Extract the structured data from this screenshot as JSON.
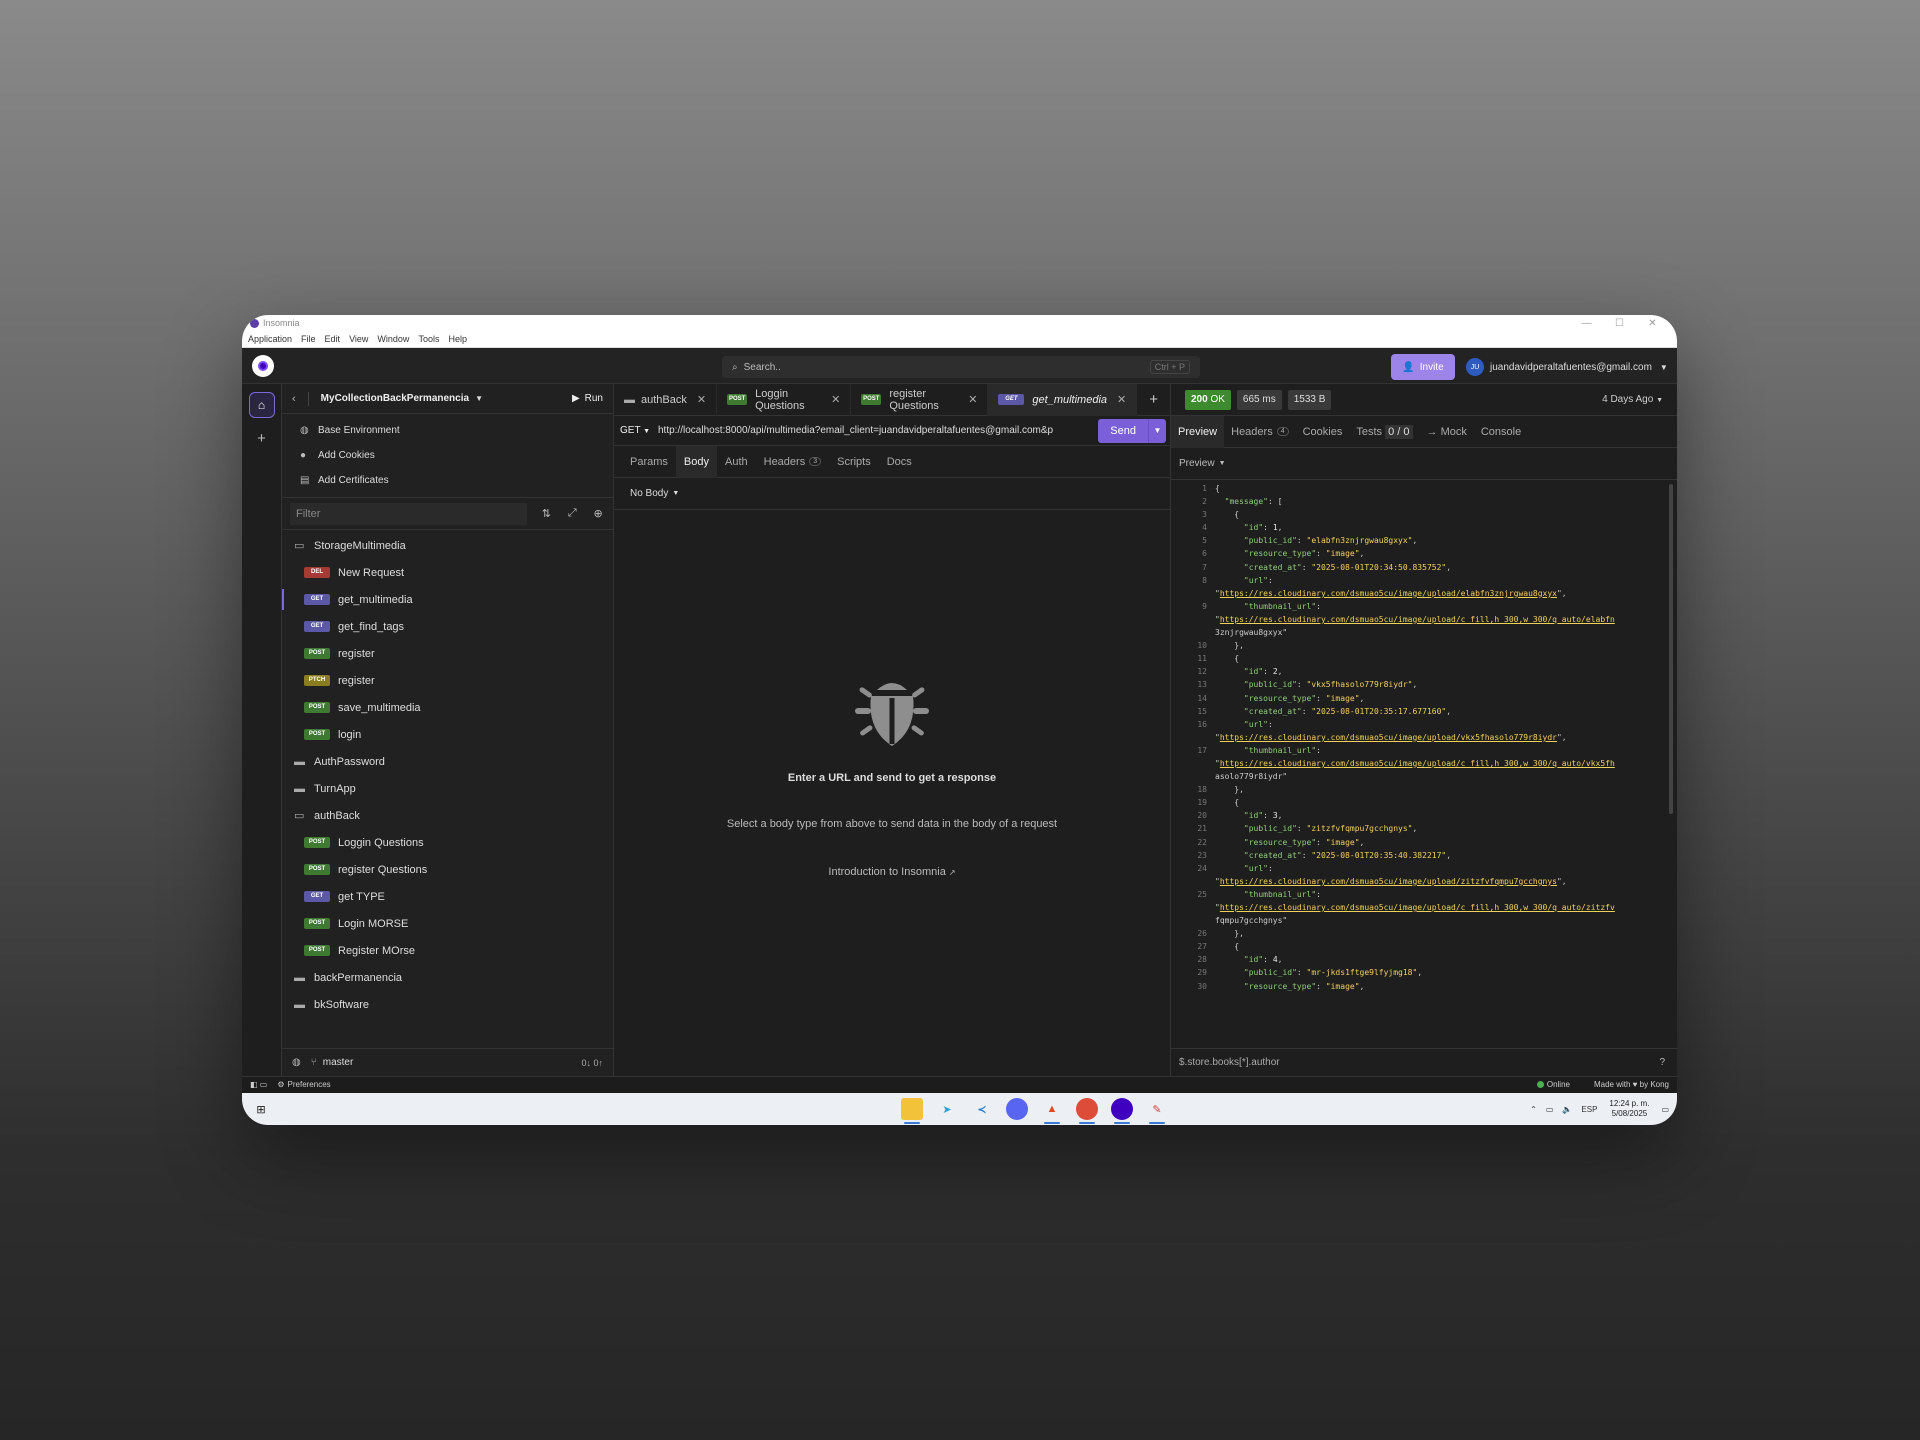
{
  "window": {
    "title": "Insomnia",
    "menu": [
      "Application",
      "File",
      "Edit",
      "View",
      "Window",
      "Tools",
      "Help"
    ]
  },
  "topbar": {
    "search_placeholder": "Search..",
    "search_shortcut": "Ctrl + P",
    "invite_label": "Invite",
    "user_initials": "JU",
    "user_email": "juandavidperaltafuentes@gmail.com"
  },
  "sidebar": {
    "collection_name": "MyCollectionBackPermanencia",
    "run_label": "Run",
    "links": [
      "Base Environment",
      "Add Cookies",
      "Add Certificates"
    ],
    "filter_placeholder": "Filter",
    "tree": [
      {
        "type": "folder",
        "label": "StorageMultimedia",
        "open": true
      },
      {
        "type": "req",
        "method": "DEL",
        "label": "New Request"
      },
      {
        "type": "req",
        "method": "GET",
        "label": "get_multimedia",
        "active": true
      },
      {
        "type": "req",
        "method": "GET",
        "label": "get_find_tags"
      },
      {
        "type": "req",
        "method": "POST",
        "label": "register"
      },
      {
        "type": "req",
        "method": "PTCH",
        "label": "register"
      },
      {
        "type": "req",
        "method": "POST",
        "label": "save_multimedia"
      },
      {
        "type": "req",
        "method": "POST",
        "label": "login"
      },
      {
        "type": "folder",
        "label": "AuthPassword"
      },
      {
        "type": "folder",
        "label": "TurnApp"
      },
      {
        "type": "folder",
        "label": "authBack",
        "open": true
      },
      {
        "type": "req",
        "method": "POST",
        "label": "Loggin Questions"
      },
      {
        "type": "req",
        "method": "POST",
        "label": "register Questions"
      },
      {
        "type": "req",
        "method": "GET",
        "label": "get TYPE"
      },
      {
        "type": "req",
        "method": "POST",
        "label": "Login MORSE"
      },
      {
        "type": "req",
        "method": "POST",
        "label": "Register MOrse"
      },
      {
        "type": "folder",
        "label": "backPermanencia"
      },
      {
        "type": "folder",
        "label": "bkSoftware"
      }
    ],
    "branch": "master",
    "sync": "0↓ 0↑"
  },
  "tabs": [
    {
      "kind": "folder",
      "label": "authBack"
    },
    {
      "kind": "POST",
      "label": "Loggin Questions"
    },
    {
      "kind": "POST",
      "label": "register Questions"
    },
    {
      "kind": "GET",
      "label": "get_multimedia",
      "active": true
    }
  ],
  "request": {
    "method": "GET",
    "url": "http://localhost:8000/api/multimedia?email_client=juandavidperaltafuentes@gmail.com&p",
    "send_label": "Send",
    "subtabs": [
      "Params",
      "Body",
      "Auth",
      "Headers",
      "Scripts",
      "Docs"
    ],
    "active_subtab": "Body",
    "headers_count": "3",
    "body_type": "No Body",
    "empty_heading": "Enter a URL and send to get a response",
    "empty_text": "Select a body type from above to send data in the body of a request",
    "intro_link": "Introduction to Insomnia"
  },
  "response": {
    "status": "200",
    "status_text": "OK",
    "time": "665 ms",
    "size": "1533 B",
    "ago": "4 Days Ago",
    "tabs": [
      "Preview",
      "Headers",
      "Cookies",
      "Tests",
      "→ Mock",
      "Console"
    ],
    "headers_count": "4",
    "tests_count": "0 / 0",
    "preview_mode": "Preview",
    "filter_placeholder": "$.store.books[*].author",
    "lines": [
      [
        "1",
        "{"
      ],
      [
        "2",
        "  \"message\": ["
      ],
      [
        "3",
        "    {"
      ],
      [
        "4",
        "      \"id\": 1,"
      ],
      [
        "5",
        "      \"public_id\": \"elabfn3znjrgwau8gxyx\","
      ],
      [
        "6",
        "      \"resource_type\": \"image\","
      ],
      [
        "7",
        "      \"created_at\": \"2025-08-01T20:34:50.835752\","
      ],
      [
        "8",
        "      \"url\":"
      ],
      [
        "",
        "\"https://res.cloudinary.com/dsmuao5cu/image/upload/elabfn3znjrgwau8gxyx\","
      ],
      [
        "9",
        "      \"thumbnail_url\":"
      ],
      [
        "",
        "\"https://res.cloudinary.com/dsmuao5cu/image/upload/c_fill,h_300,w_300/q_auto/elabfn"
      ],
      [
        "",
        "3znjrgwau8gxyx\""
      ],
      [
        "10",
        "    },"
      ],
      [
        "11",
        "    {"
      ],
      [
        "12",
        "      \"id\": 2,"
      ],
      [
        "13",
        "      \"public_id\": \"vkx5fhasolo779r8iydr\","
      ],
      [
        "14",
        "      \"resource_type\": \"image\","
      ],
      [
        "15",
        "      \"created_at\": \"2025-08-01T20:35:17.677160\","
      ],
      [
        "16",
        "      \"url\":"
      ],
      [
        "",
        "\"https://res.cloudinary.com/dsmuao5cu/image/upload/vkx5fhasolo779r8iydr\","
      ],
      [
        "17",
        "      \"thumbnail_url\":"
      ],
      [
        "",
        "\"https://res.cloudinary.com/dsmuao5cu/image/upload/c_fill,h_300,w_300/q_auto/vkx5fh"
      ],
      [
        "",
        "asolo779r8iydr\""
      ],
      [
        "18",
        "    },"
      ],
      [
        "19",
        "    {"
      ],
      [
        "20",
        "      \"id\": 3,"
      ],
      [
        "21",
        "      \"public_id\": \"zitzfvfqmpu7gcchgnys\","
      ],
      [
        "22",
        "      \"resource_type\": \"image\","
      ],
      [
        "23",
        "      \"created_at\": \"2025-08-01T20:35:40.382217\","
      ],
      [
        "24",
        "      \"url\":"
      ],
      [
        "",
        "\"https://res.cloudinary.com/dsmuao5cu/image/upload/zitzfvfqmpu7gcchgnys\","
      ],
      [
        "25",
        "      \"thumbnail_url\":"
      ],
      [
        "",
        "\"https://res.cloudinary.com/dsmuao5cu/image/upload/c_fill,h_300,w_300/q_auto/zitzfv"
      ],
      [
        "",
        "fqmpu7gcchgnys\""
      ],
      [
        "26",
        "    },"
      ],
      [
        "27",
        "    {"
      ],
      [
        "28",
        "      \"id\": 4,"
      ],
      [
        "29",
        "      \"public_id\": \"mr-jkds1ftge9lfyjmg18\","
      ],
      [
        "30",
        "      \"resource_type\": \"image\","
      ]
    ]
  },
  "statusbar": {
    "preferences": "Preferences",
    "online": "Online",
    "made_with": "Made with ♥ by Kong"
  },
  "taskbar": {
    "lang": "ESP",
    "time": "12:24 p. m.",
    "date": "5/08/2025"
  }
}
